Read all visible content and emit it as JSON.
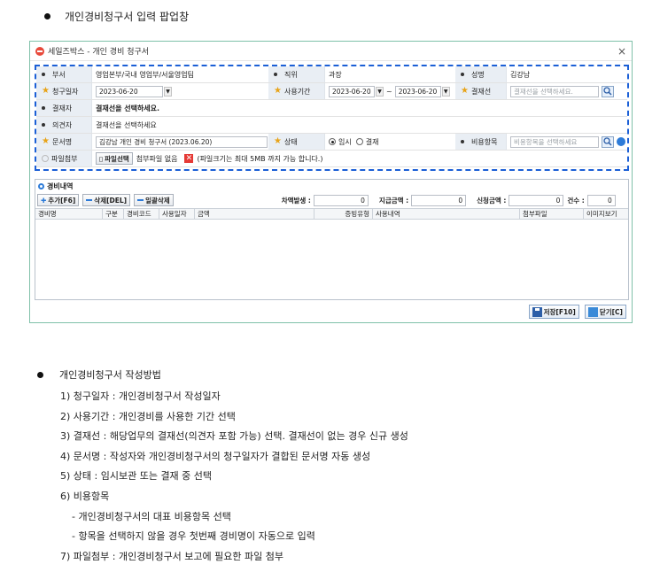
{
  "heading_top": "개인경비청구서 입력 팝업창",
  "window": {
    "title": "세일즈박스 - 개인 경비 청구서",
    "close": "×",
    "form": {
      "dept_label": "부서",
      "dept_value": "영업본부/국내 영업부/서울영업팀",
      "position_label": "직위",
      "position_value": "과장",
      "name_label": "성명",
      "name_value": "김강남",
      "claim_date_label": "청구일자",
      "claim_date_value": "2023-06-20",
      "use_period_label": "사용기간",
      "use_period_from": "2023-06-20",
      "use_period_sep": "~",
      "use_period_to": "2023-06-20",
      "approval_line_label": "결재선",
      "approval_line_placeholder": "결재선을 선택하세요.",
      "approver_label": "결재자",
      "approver_value": "결재선을 선택하세요.",
      "reviewer_label": "의견자",
      "reviewer_value": "결재선을 선택하세요",
      "doc_name_label": "문서명",
      "doc_name_value": "김강남 개인 경비 청구서 (2023.06.20)",
      "status_label": "상태",
      "status_temp": "임시",
      "status_approval": "결재",
      "expense_item_label": "비용항목",
      "expense_item_placeholder": "비용항목을 선택하세요",
      "attach_label": "파일첨부",
      "attach_button": "파일선택",
      "attach_none": "첨부파일 없음",
      "attach_note": "(파일크기는 최대 5MB 까지 가능 합니다.)"
    },
    "expense_list": {
      "title": "경비내역",
      "add_button": "추가[F6]",
      "delete_button": "삭제[DEL]",
      "bulk_delete_button": "일괄삭제",
      "diff_label": "차액발생 :",
      "diff_value": "0",
      "paid_label": "지급금액 :",
      "paid_value": "0",
      "requested_label": "신청금액 :",
      "requested_value": "0",
      "count_label": "건수 :",
      "count_value": "0",
      "columns": [
        "경비명",
        "구분",
        "경비코드",
        "사용일자",
        "금액",
        "증빙유형",
        "사용내역",
        "첨부파일",
        "이미지보기"
      ]
    },
    "save_button": "저장[F10]",
    "close_button": "닫기[C]"
  },
  "heading_bottom": "개인경비청구서 작성방법",
  "steps": [
    "1) 청구일자 : 개인경비청구서 작성일자",
    "2) 사용기간 : 개인경비를 사용한 기간 선택",
    "3) 결재선 : 해당업무의 결재선(의견자 포함 가능) 선택. 결재선이 없는 경우 신규 생성",
    "4) 문서명 : 작성자와 개인경비청구서의 청구일자가 결합된 문서명 자동 생성",
    "5) 상태 : 임시보관 또는 결재 중 선택",
    "6) 비용항목",
    "- 개인경비청구서의 대표 비용항목 선택",
    "- 항목을 선택하지 않을 경우 첫번째 경비명이 자동으로 입력",
    "7) 파일첨부 : 개인경비청구서 보고에 필요한 파일 첨부"
  ]
}
